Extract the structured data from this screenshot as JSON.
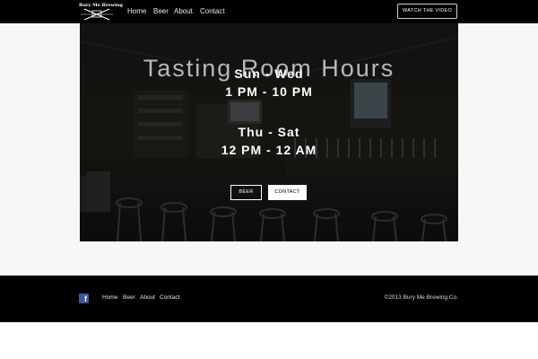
{
  "brand": {
    "logo_text": "Bury Me Brewing"
  },
  "nav": {
    "items": [
      {
        "label": "Home"
      },
      {
        "label": "Beer"
      },
      {
        "label": "About"
      },
      {
        "label": "Contact"
      }
    ],
    "watch_label": "WATCH THE VIDEO"
  },
  "hero": {
    "title": "Tasting Room Hours",
    "schedule": [
      {
        "days": "Sun - Wed",
        "hours": "1 PM - 10 PM"
      },
      {
        "days": "Thu - Sat",
        "hours": "12 PM - 12 AM"
      }
    ],
    "buttons": {
      "beer": "BEER",
      "contact": "CONTACT"
    }
  },
  "footer": {
    "social_icon": "facebook-icon",
    "links": [
      {
        "label": "Home"
      },
      {
        "label": "Beer"
      },
      {
        "label": "About"
      },
      {
        "label": "Contact"
      }
    ],
    "copyright": "©2013 Bury Me Brewing Co."
  },
  "colors": {
    "nav_bg": "#000000",
    "footer_bg": "#000000",
    "page_band": "#f7f7f7",
    "facebook": "#3b5998"
  }
}
